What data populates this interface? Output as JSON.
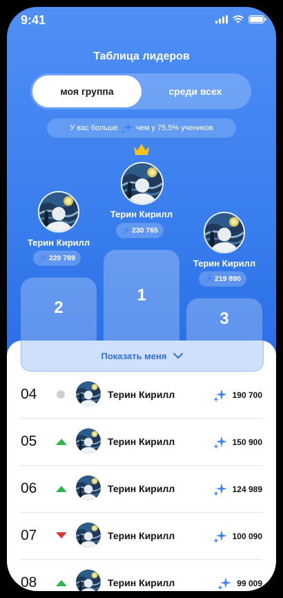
{
  "status_bar": {
    "time": "9:41"
  },
  "header": {
    "title": "Таблица лидеров"
  },
  "tabs": [
    {
      "label": "моя группа",
      "active": true
    },
    {
      "label": "среди всех",
      "active": false
    }
  ],
  "info_banner": {
    "text_before": "У вас больше",
    "text_after": "чем у 75,5% учеников"
  },
  "podium": [
    {
      "place": "1",
      "name": "Терин Кирилл",
      "score": "230 765"
    },
    {
      "place": "2",
      "name": "Терин Кирилл",
      "score": "220 789"
    },
    {
      "place": "3",
      "name": "Терин Кирилл",
      "score": "219 890"
    }
  ],
  "show_me_button": {
    "label": "Показать меня"
  },
  "leaderboard": [
    {
      "rank": "04",
      "trend": "neutral",
      "name": "Терин Кирилл",
      "score": "190 700"
    },
    {
      "rank": "05",
      "trend": "up",
      "name": "Терин Кирилл",
      "score": "150 900"
    },
    {
      "rank": "06",
      "trend": "up",
      "name": "Терин Кирилл",
      "score": "124 989"
    },
    {
      "rank": "07",
      "trend": "down",
      "name": "Терин Кирилл",
      "score": "100 090"
    },
    {
      "rank": "08",
      "trend": "up",
      "name": "Терин Кирилл",
      "score": "99 009"
    }
  ],
  "colors": {
    "accent": "#2f6fd6",
    "up": "#2eb24a",
    "down": "#e0343a",
    "neutral": "#d0d0d0",
    "crown": "#f6c21c"
  },
  "icons": {
    "score": "sparkle-icon",
    "crown": "crown-icon",
    "chevron": "chevron-down-icon"
  }
}
